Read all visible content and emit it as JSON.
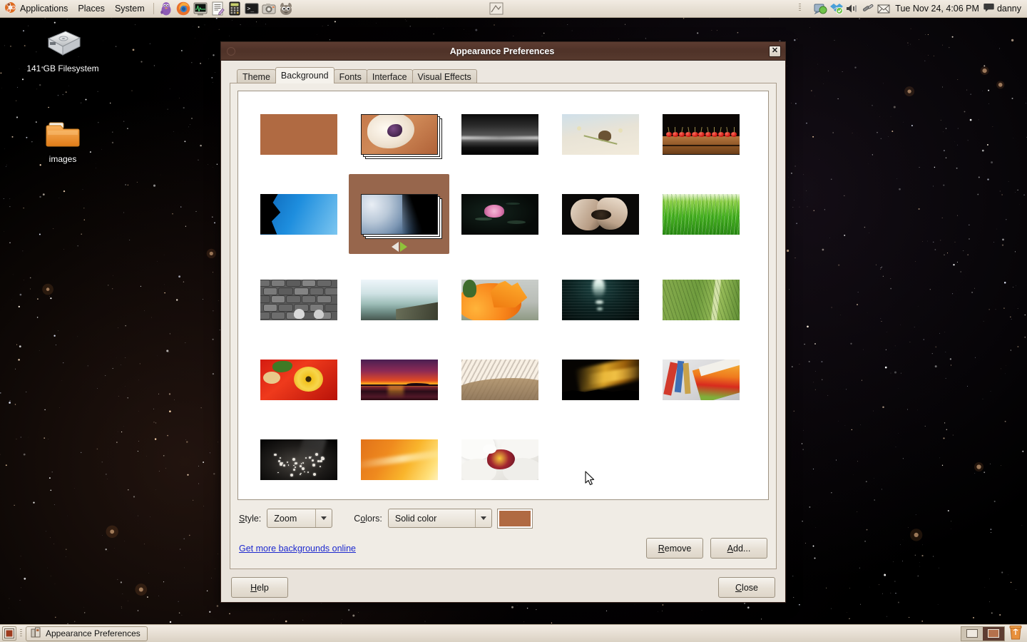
{
  "panel": {
    "menus": [
      "Applications",
      "Places",
      "System"
    ],
    "launchers": [
      "pidgin-icon",
      "firefox-icon",
      "system-monitor-icon",
      "text-editor-icon",
      "calculator-icon",
      "terminal-icon",
      "screenshot-icon",
      "gimp-icon"
    ],
    "tray": [
      "network-icon",
      "dropbox-icon",
      "volume-icon",
      "bluetooth-icon",
      "mail-icon"
    ],
    "clock": "Tue Nov 24,  4:06 PM",
    "user": "danny"
  },
  "desktop": {
    "icons": [
      {
        "name": "141 GB Filesystem",
        "icon": "hard-drive-icon"
      },
      {
        "name": "images",
        "icon": "folder-icon"
      }
    ]
  },
  "window": {
    "title": "Appearance Preferences",
    "close_label": "✕",
    "tabs": [
      {
        "label": "Theme",
        "active": false
      },
      {
        "label": "Background",
        "active": true
      },
      {
        "label": "Fonts",
        "active": false
      },
      {
        "label": "Interface",
        "active": false
      },
      {
        "label": "Visual Effects",
        "active": false
      }
    ],
    "wallpapers": [
      {
        "id": "solid-brown",
        "label": "Solid brown color",
        "selected": false,
        "slideshow": false
      },
      {
        "id": "desert-shell",
        "label": "Shell on desert sand",
        "selected": false,
        "slideshow": true
      },
      {
        "id": "dark-seascape",
        "label": "Dark seascape",
        "selected": false,
        "slideshow": false
      },
      {
        "id": "butterfly",
        "label": "Butterfly on dry flowers",
        "selected": false,
        "slideshow": false
      },
      {
        "id": "cherries",
        "label": "Cherries on wooden table",
        "selected": false,
        "slideshow": false
      },
      {
        "id": "climber-blue",
        "label": "Climber against blue sky",
        "selected": false,
        "slideshow": false
      },
      {
        "id": "earth-space",
        "label": "Earth from space",
        "selected": true,
        "slideshow": true
      },
      {
        "id": "lotus",
        "label": "Pink lotus on dark pond",
        "selected": false,
        "slideshow": false
      },
      {
        "id": "hands-seeds",
        "label": "Hands holding seeds",
        "selected": false,
        "slideshow": false
      },
      {
        "id": "green-grass",
        "label": "Green grass",
        "selected": false,
        "slideshow": false
      },
      {
        "id": "cobblestone",
        "label": "Grey cobblestone wall",
        "selected": false,
        "slideshow": false
      },
      {
        "id": "misty-pier",
        "label": "Misty pier on lake",
        "selected": false,
        "slideshow": false
      },
      {
        "id": "orange-flower",
        "label": "Orange flower close-up",
        "selected": false,
        "slideshow": false
      },
      {
        "id": "water-light",
        "label": "Light reflecting on water",
        "selected": false,
        "slideshow": false
      },
      {
        "id": "green-leaf",
        "label": "Green leaf veins",
        "selected": false,
        "slideshow": false
      },
      {
        "id": "red-flowers",
        "label": "Red and yellow flowers",
        "selected": false,
        "slideshow": false
      },
      {
        "id": "sunset-lake",
        "label": "Crimson sunset over lake",
        "selected": false,
        "slideshow": false
      },
      {
        "id": "sand-dunes",
        "label": "Rippled sand dunes",
        "selected": false,
        "slideshow": false
      },
      {
        "id": "golden-clouds",
        "label": "Golden clouds at dusk",
        "selected": false,
        "slideshow": false
      },
      {
        "id": "art-supplies",
        "label": "Coloured pencils and paint",
        "selected": false,
        "slideshow": false
      },
      {
        "id": "dark-droplets",
        "label": "Droplets on dark surface",
        "selected": false,
        "slideshow": false
      },
      {
        "id": "orange-gradient",
        "label": "Orange gradient",
        "selected": false,
        "slideshow": false
      },
      {
        "id": "white-orchid",
        "label": "White orchid",
        "selected": false,
        "slideshow": false
      }
    ],
    "slideshow_nav": {
      "prev": "prev-arrow-icon",
      "next": "next-arrow-icon"
    },
    "style": {
      "label": "Style:",
      "value": "Zoom"
    },
    "colors": {
      "label": "Colors:",
      "value": "Solid color",
      "swatch_hex": "#b06a42"
    },
    "link": "Get more backgrounds online",
    "buttons": {
      "remove": "Remove",
      "add": "Add...",
      "help": "Help",
      "close": "Close"
    }
  },
  "taskbar": {
    "show_desktop": "show-desktop-icon",
    "task": {
      "label": "Appearance Preferences",
      "icon": "appearance-icon"
    },
    "workspaces": [
      "Workspace 1",
      "Workspace 2"
    ],
    "trash": "trash-icon"
  }
}
